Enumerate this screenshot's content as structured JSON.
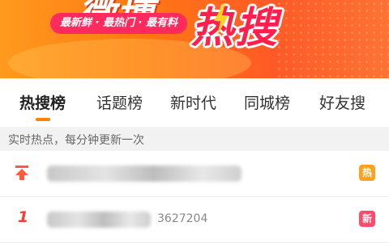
{
  "banner": {
    "title_left": "微博",
    "title_right": "热搜",
    "slogan": "最新鲜 · 最热门 · 最有料"
  },
  "tabs": [
    {
      "label": "热搜榜",
      "active": true
    },
    {
      "label": "话题榜",
      "active": false
    },
    {
      "label": "新时代",
      "active": false
    },
    {
      "label": "同城榜",
      "active": false
    },
    {
      "label": "好友搜",
      "active": false
    }
  ],
  "info": {
    "text": "实时热点，每分钟更新一次"
  },
  "list": [
    {
      "rank_icon": "pin-top-icon",
      "badge": "热",
      "badge_color": "#ffa01e"
    },
    {
      "rank": "1",
      "heat": "3627204",
      "badge": "新",
      "badge_color": "#ff4a6a"
    }
  ],
  "colors": {
    "accent": "#ff8200",
    "rank_red": "#ff3b30"
  }
}
